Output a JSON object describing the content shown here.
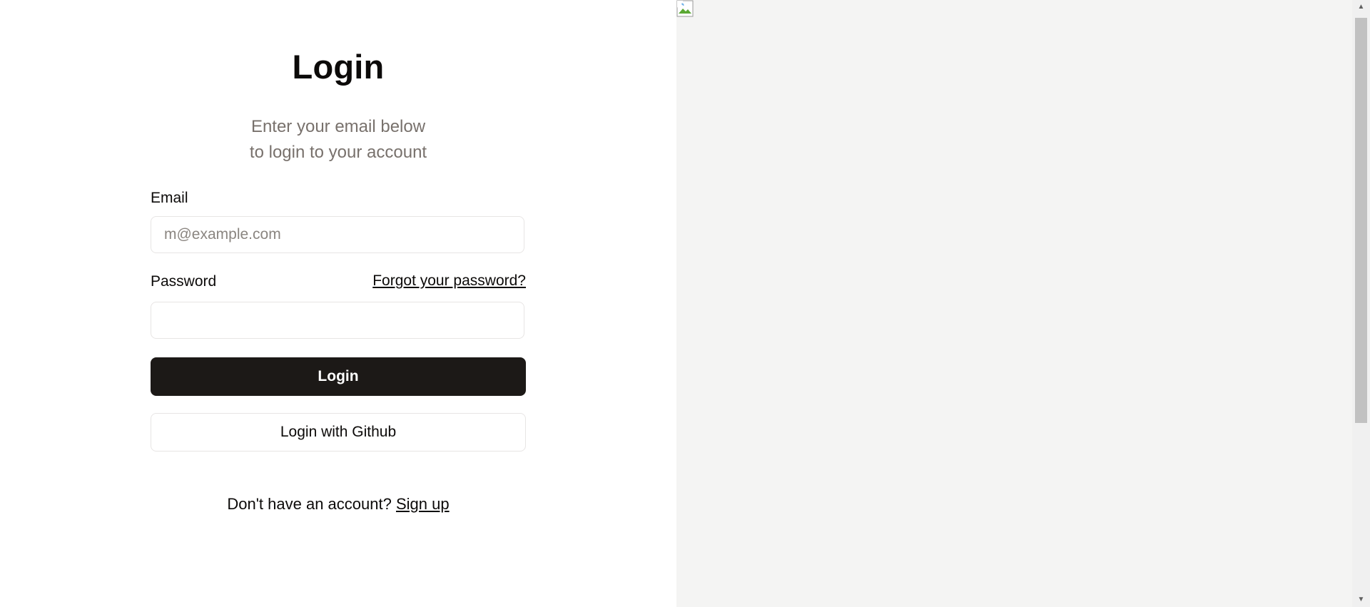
{
  "login": {
    "title": "Login",
    "subtitle_line1": "Enter your email below",
    "subtitle_line2": "to login to your account",
    "email_label": "Email",
    "email_placeholder": "m@example.com",
    "email_value": "",
    "password_label": "Password",
    "password_value": "",
    "forgot_link": "Forgot your password?",
    "login_button": "Login",
    "github_button": "Login with Github",
    "signup_prompt": "Don't have an account?",
    "signup_link": "Sign up"
  },
  "side_panel": {
    "image_state": "broken-image-icon"
  },
  "colors": {
    "primary": "#1c1917",
    "muted_text": "#78716c",
    "border": "#e7e5e4",
    "side_panel_bg": "#f4f4f3"
  }
}
